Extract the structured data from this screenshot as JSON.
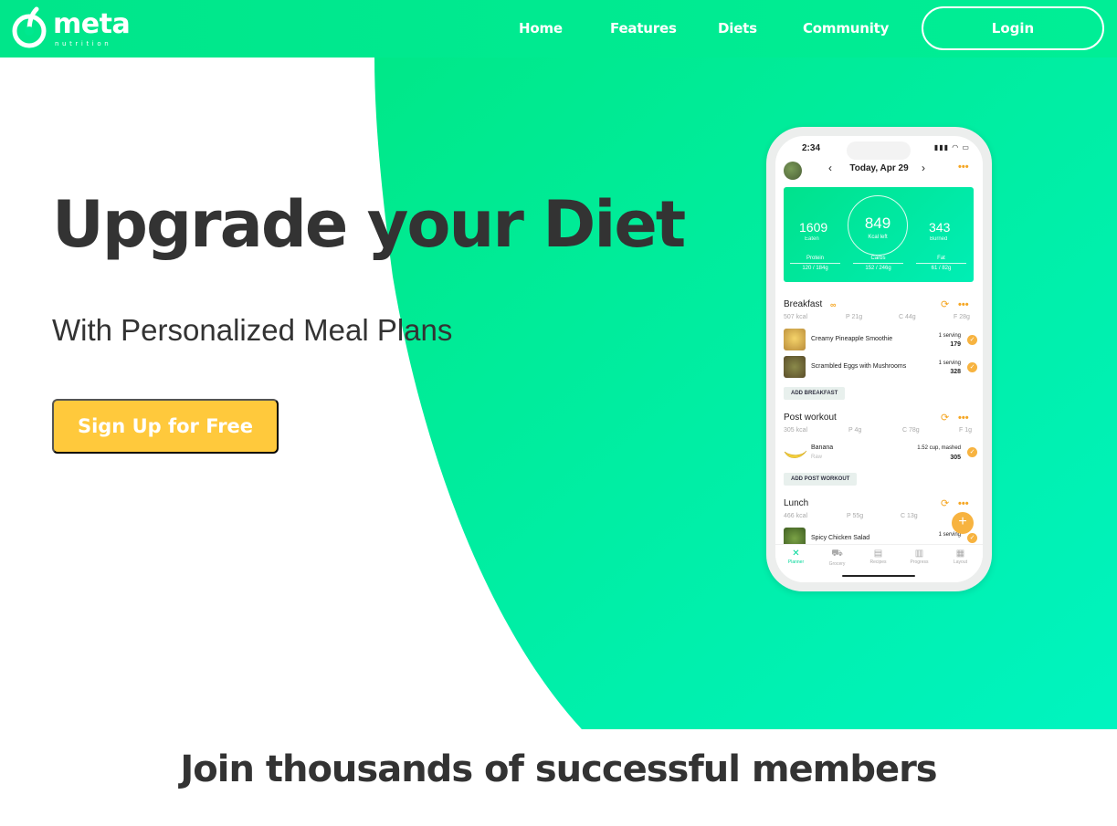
{
  "brand": {
    "name": "meta",
    "tagline": "nutrition"
  },
  "nav": {
    "links": [
      "Home",
      "Features",
      "Diets",
      "Community"
    ],
    "login_label": "Login"
  },
  "hero": {
    "title": "Upgrade your Diet",
    "subtitle": "With Personalized Meal Plans",
    "cta_label": "Sign Up for Free"
  },
  "phone": {
    "status_time": "2:34",
    "date_label": "Today, Apr 29",
    "summary": {
      "eaten_value": "1609",
      "eaten_label": "Eaten",
      "left_value": "849",
      "left_label": "Kcal left",
      "burned_value": "343",
      "burned_label": "Burned",
      "macros": [
        {
          "label": "Protein",
          "value": "120 / 184g"
        },
        {
          "label": "Carbs",
          "value": "152 / 246g"
        },
        {
          "label": "Fat",
          "value": "61 / 82g"
        }
      ]
    },
    "meals": [
      {
        "title": "Breakfast",
        "kcal": "507 kcal",
        "p": "P 21g",
        "c": "C 44g",
        "f": "F 28g",
        "items": [
          {
            "name": "Creamy Pineapple Smoothie",
            "sub": "",
            "serving": "1 serving",
            "kcal": "179"
          },
          {
            "name": "Scrambled Eggs with Mushrooms",
            "sub": "",
            "serving": "1 serving",
            "kcal": "328"
          }
        ],
        "add_label": "ADD BREAKFAST"
      },
      {
        "title": "Post workout",
        "kcal": "305 kcal",
        "p": "P 4g",
        "c": "C 78g",
        "f": "F 1g",
        "items": [
          {
            "name": "Banana",
            "sub": "Raw",
            "serving": "1.52 cup, mashed",
            "kcal": "305"
          }
        ],
        "add_label": "ADD POST WORKOUT"
      },
      {
        "title": "Lunch",
        "kcal": "466 kcal",
        "p": "P 55g",
        "c": "C 13g",
        "f": "",
        "items": [
          {
            "name": "Spicy Chicken Salad",
            "sub": "",
            "serving": "1 serving",
            "kcal": ""
          }
        ],
        "add_label": ""
      }
    ],
    "tabs": [
      "Planner",
      "Grocery",
      "Recipes",
      "Progress",
      "Layout"
    ]
  },
  "section": {
    "heading": "Join thousands of successful members"
  },
  "colors": {
    "green": "#00e890",
    "accent_yellow": "#ffc93c",
    "orange": "#f5a623",
    "text": "#333333"
  }
}
